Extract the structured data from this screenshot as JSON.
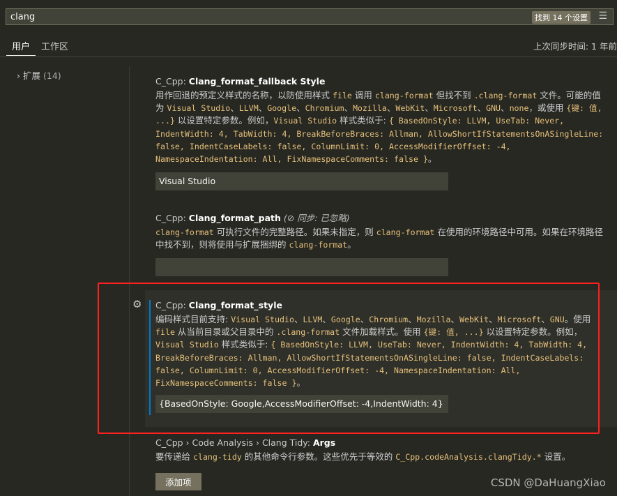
{
  "search": {
    "value": "clang",
    "result_count": "找到 14 个设置",
    "filter_icon": "clear-filter-icon"
  },
  "tabs": [
    {
      "label": "用户",
      "active": true
    },
    {
      "label": "工作区",
      "active": false
    }
  ],
  "sync_status": "上次同步时间: 1 年前",
  "sidebar": {
    "items": [
      {
        "label": "扩展",
        "count": "(14)"
      }
    ]
  },
  "settings": [
    {
      "prefix": "C_Cpp: ",
      "name": "Clang_format_fallback Style",
      "description": [
        [
          "t",
          "用作回退的预定义样式的名称，以防使用样式 "
        ],
        [
          "c",
          "file"
        ],
        [
          "t",
          " 调用 "
        ],
        [
          "c",
          "clang-format"
        ],
        [
          "t",
          " 但找不到 "
        ],
        [
          "c",
          ".clang-format"
        ],
        [
          "t",
          " 文件。可能的值为 "
        ],
        [
          "c",
          "Visual Studio"
        ],
        [
          "t",
          "、"
        ],
        [
          "c",
          "LLVM"
        ],
        [
          "t",
          "、"
        ],
        [
          "c",
          "Google"
        ],
        [
          "t",
          "、"
        ],
        [
          "c",
          "Chromium"
        ],
        [
          "t",
          "、"
        ],
        [
          "c",
          "Mozilla"
        ],
        [
          "t",
          "、"
        ],
        [
          "c",
          "WebKit"
        ],
        [
          "t",
          "、"
        ],
        [
          "c",
          "Microsoft"
        ],
        [
          "t",
          "、"
        ],
        [
          "c",
          "GNU"
        ],
        [
          "t",
          "、"
        ],
        [
          "c",
          "none"
        ],
        [
          "t",
          "，或使用 "
        ],
        [
          "c",
          "{键: 值, ...}"
        ],
        [
          "t",
          " 以设置特定参数。例如，"
        ],
        [
          "c",
          "Visual Studio"
        ],
        [
          "t",
          " 样式类似于: "
        ],
        [
          "c",
          "{ BasedOnStyle: LLVM, UseTab: Never, IndentWidth: 4, TabWidth: 4, BreakBeforeBraces: Allman, AllowShortIfStatementsOnASingleLine: false, IndentCaseLabels: false, ColumnLimit: 0, AccessModifierOffset: -4, NamespaceIndentation: All, FixNamespaceComments: false }"
        ],
        [
          "t",
          "。"
        ]
      ],
      "value": "Visual Studio"
    },
    {
      "prefix": "C_Cpp: ",
      "name": "Clang_format_path",
      "sync_note": "同步: 已忽略",
      "sync_icon": "sync-ignored-icon",
      "description": [
        [
          "c",
          "clang-format"
        ],
        [
          "t",
          " 可执行文件的完整路径。如果未指定，则 "
        ],
        [
          "c",
          "clang-format"
        ],
        [
          "t",
          " 在使用的环境路径中可用。如果在环境路径中找不到，则将使用与扩展捆绑的 "
        ],
        [
          "c",
          "clang-format"
        ],
        [
          "t",
          "。"
        ]
      ],
      "value": ""
    },
    {
      "prefix": "C_Cpp: ",
      "name": "Clang_format_style",
      "focused": true,
      "description": [
        [
          "t",
          "编码样式目前支持: "
        ],
        [
          "c",
          "Visual Studio"
        ],
        [
          "t",
          "、"
        ],
        [
          "c",
          "LLVM"
        ],
        [
          "t",
          "、"
        ],
        [
          "c",
          "Google"
        ],
        [
          "t",
          "、"
        ],
        [
          "c",
          "Chromium"
        ],
        [
          "t",
          "、"
        ],
        [
          "c",
          "Mozilla"
        ],
        [
          "t",
          "、"
        ],
        [
          "c",
          "WebKit"
        ],
        [
          "t",
          "、"
        ],
        [
          "c",
          "Microsoft"
        ],
        [
          "t",
          "、"
        ],
        [
          "c",
          "GNU"
        ],
        [
          "t",
          "。使用 "
        ],
        [
          "c",
          "file"
        ],
        [
          "t",
          " 从当前目录或父目录中的 "
        ],
        [
          "c",
          ".clang-format"
        ],
        [
          "t",
          " 文件加载样式。使用 "
        ],
        [
          "c",
          "{键: 值, ...}"
        ],
        [
          "t",
          " 以设置特定参数。例如，"
        ],
        [
          "c",
          "Visual Studio"
        ],
        [
          "t",
          " 样式类似于: "
        ],
        [
          "c",
          "{ BasedOnStyle: LLVM, UseTab: Never, IndentWidth: 4, TabWidth: 4, BreakBeforeBraces: Allman, AllowShortIfStatementsOnASingleLine: false, IndentCaseLabels: false, ColumnLimit: 0, AccessModifierOffset: -4, NamespaceIndentation: All, FixNamespaceComments: false }"
        ],
        [
          "t",
          "。"
        ]
      ],
      "value": "{BasedOnStyle: Google,AccessModifierOffset: -4,IndentWidth: 4}"
    },
    {
      "prefix": "C_Cpp › Code Analysis › Clang Tidy: ",
      "name": "Args",
      "description": [
        [
          "t",
          "要传递给 "
        ],
        [
          "c",
          "clang-tidy"
        ],
        [
          "t",
          " 的其他命令行参数。这些优先于等效的 "
        ],
        [
          "c",
          "C_Cpp.codeAnalysis.clangTidy.*"
        ],
        [
          "t",
          " 设置。"
        ]
      ],
      "button": "添加项"
    }
  ],
  "colors": {
    "background": "#272822",
    "code": "#e6c07b",
    "focus_bar": "#007acc",
    "annotation_box": "#ff2020"
  },
  "watermark": "CSDN @DaHuangXiao"
}
